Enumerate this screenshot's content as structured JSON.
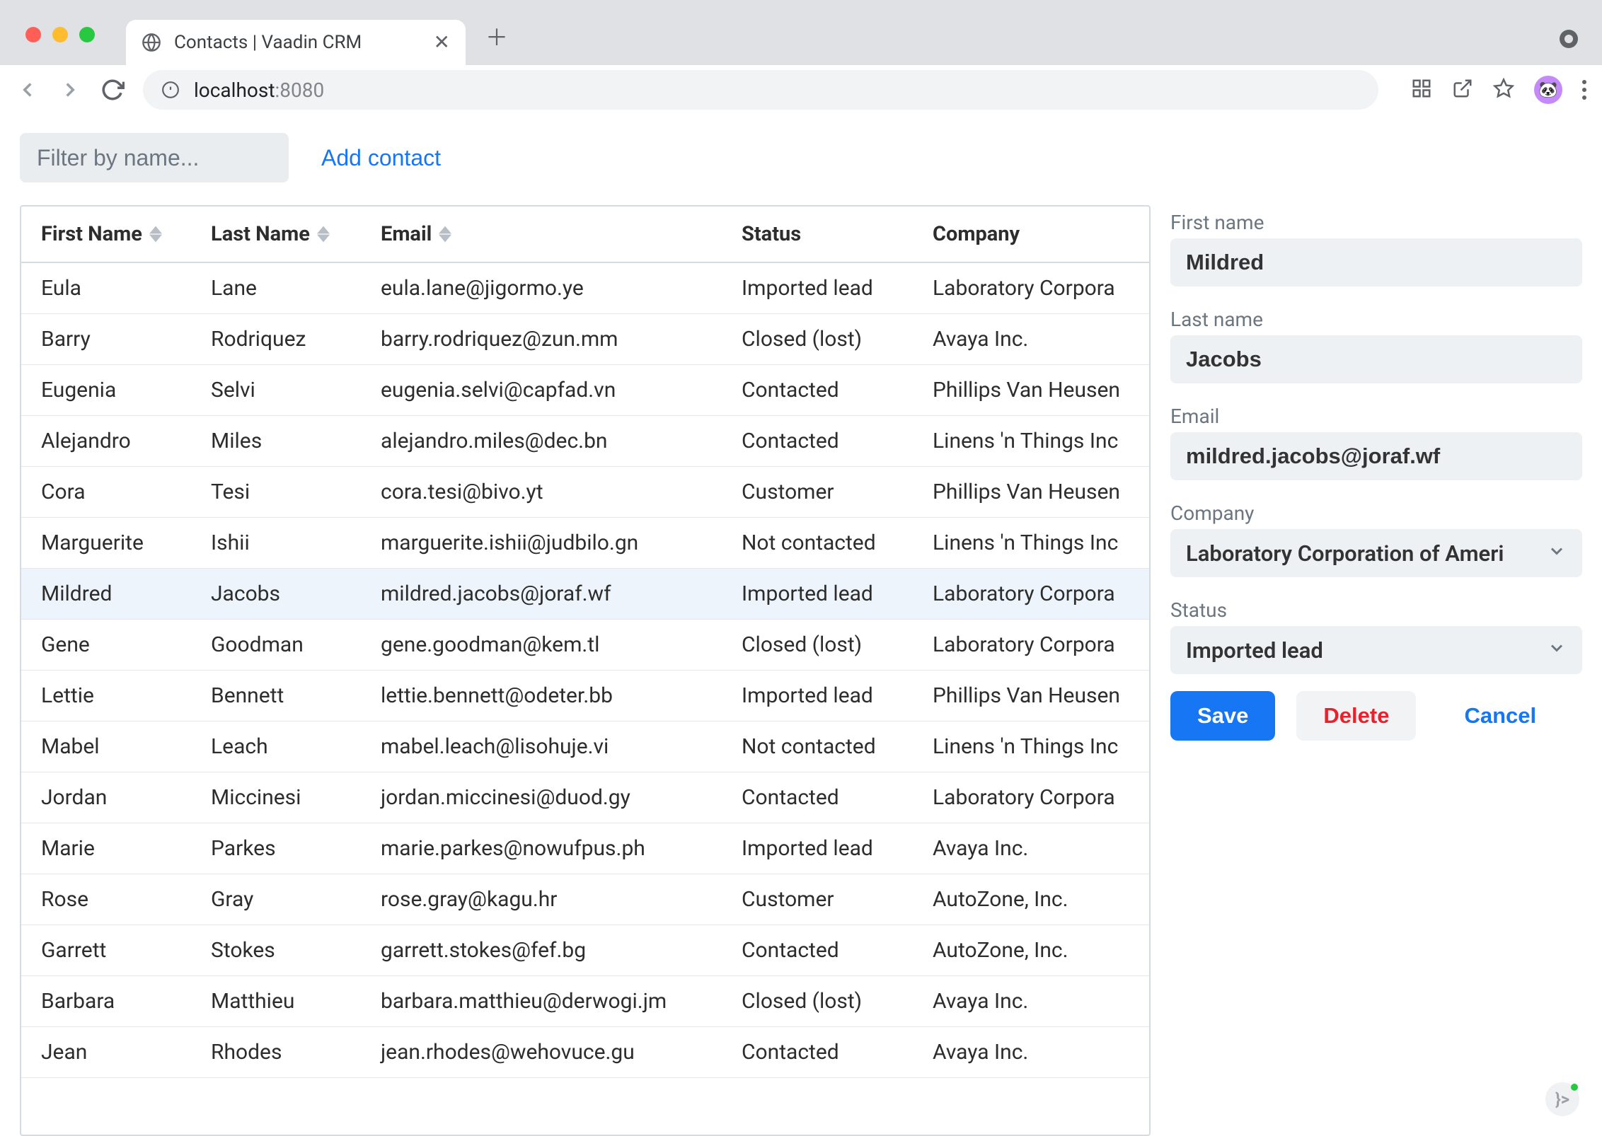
{
  "browser": {
    "tab_title": "Contacts | Vaadin CRM",
    "url_host": "localhost",
    "url_port": ":8080"
  },
  "toolbar": {
    "filter_placeholder": "Filter by name...",
    "add_contact_label": "Add contact"
  },
  "table": {
    "columns": [
      "First Name",
      "Last Name",
      "Email",
      "Status",
      "Company"
    ],
    "selected_index": 6,
    "rows": [
      {
        "first": "Eula",
        "last": "Lane",
        "email": "eula.lane@jigormo.ye",
        "status": "Imported lead",
        "company": "Laboratory Corpora"
      },
      {
        "first": "Barry",
        "last": "Rodriquez",
        "email": "barry.rodriquez@zun.mm",
        "status": "Closed (lost)",
        "company": "Avaya Inc."
      },
      {
        "first": "Eugenia",
        "last": "Selvi",
        "email": "eugenia.selvi@capfad.vn",
        "status": "Contacted",
        "company": "Phillips Van Heusen"
      },
      {
        "first": "Alejandro",
        "last": "Miles",
        "email": "alejandro.miles@dec.bn",
        "status": "Contacted",
        "company": "Linens 'n Things Inc"
      },
      {
        "first": "Cora",
        "last": "Tesi",
        "email": "cora.tesi@bivo.yt",
        "status": "Customer",
        "company": "Phillips Van Heusen"
      },
      {
        "first": "Marguerite",
        "last": "Ishii",
        "email": "marguerite.ishii@judbilo.gn",
        "status": "Not contacted",
        "company": "Linens 'n Things Inc"
      },
      {
        "first": "Mildred",
        "last": "Jacobs",
        "email": "mildred.jacobs@joraf.wf",
        "status": "Imported lead",
        "company": "Laboratory Corpora"
      },
      {
        "first": "Gene",
        "last": "Goodman",
        "email": "gene.goodman@kem.tl",
        "status": "Closed (lost)",
        "company": "Laboratory Corpora"
      },
      {
        "first": "Lettie",
        "last": "Bennett",
        "email": "lettie.bennett@odeter.bb",
        "status": "Imported lead",
        "company": "Phillips Van Heusen"
      },
      {
        "first": "Mabel",
        "last": "Leach",
        "email": "mabel.leach@lisohuje.vi",
        "status": "Not contacted",
        "company": "Linens 'n Things Inc"
      },
      {
        "first": "Jordan",
        "last": "Miccinesi",
        "email": "jordan.miccinesi@duod.gy",
        "status": "Contacted",
        "company": "Laboratory Corpora"
      },
      {
        "first": "Marie",
        "last": "Parkes",
        "email": "marie.parkes@nowufpus.ph",
        "status": "Imported lead",
        "company": "Avaya Inc."
      },
      {
        "first": "Rose",
        "last": "Gray",
        "email": "rose.gray@kagu.hr",
        "status": "Customer",
        "company": "AutoZone, Inc."
      },
      {
        "first": "Garrett",
        "last": "Stokes",
        "email": "garrett.stokes@fef.bg",
        "status": "Contacted",
        "company": "AutoZone, Inc."
      },
      {
        "first": "Barbara",
        "last": "Matthieu",
        "email": "barbara.matthieu@derwogi.jm",
        "status": "Closed (lost)",
        "company": "Avaya Inc."
      },
      {
        "first": "Jean",
        "last": "Rhodes",
        "email": "jean.rhodes@wehovuce.gu",
        "status": "Contacted",
        "company": "Avaya Inc."
      }
    ]
  },
  "form": {
    "labels": {
      "first_name": "First name",
      "last_name": "Last name",
      "email": "Email",
      "company": "Company",
      "status": "Status"
    },
    "values": {
      "first_name": "Mildred",
      "last_name": "Jacobs",
      "email": "mildred.jacobs@joraf.wf",
      "company": "Laboratory Corporation of Ameri",
      "status": "Imported lead"
    },
    "buttons": {
      "save": "Save",
      "delete": "Delete",
      "cancel": "Cancel"
    }
  }
}
